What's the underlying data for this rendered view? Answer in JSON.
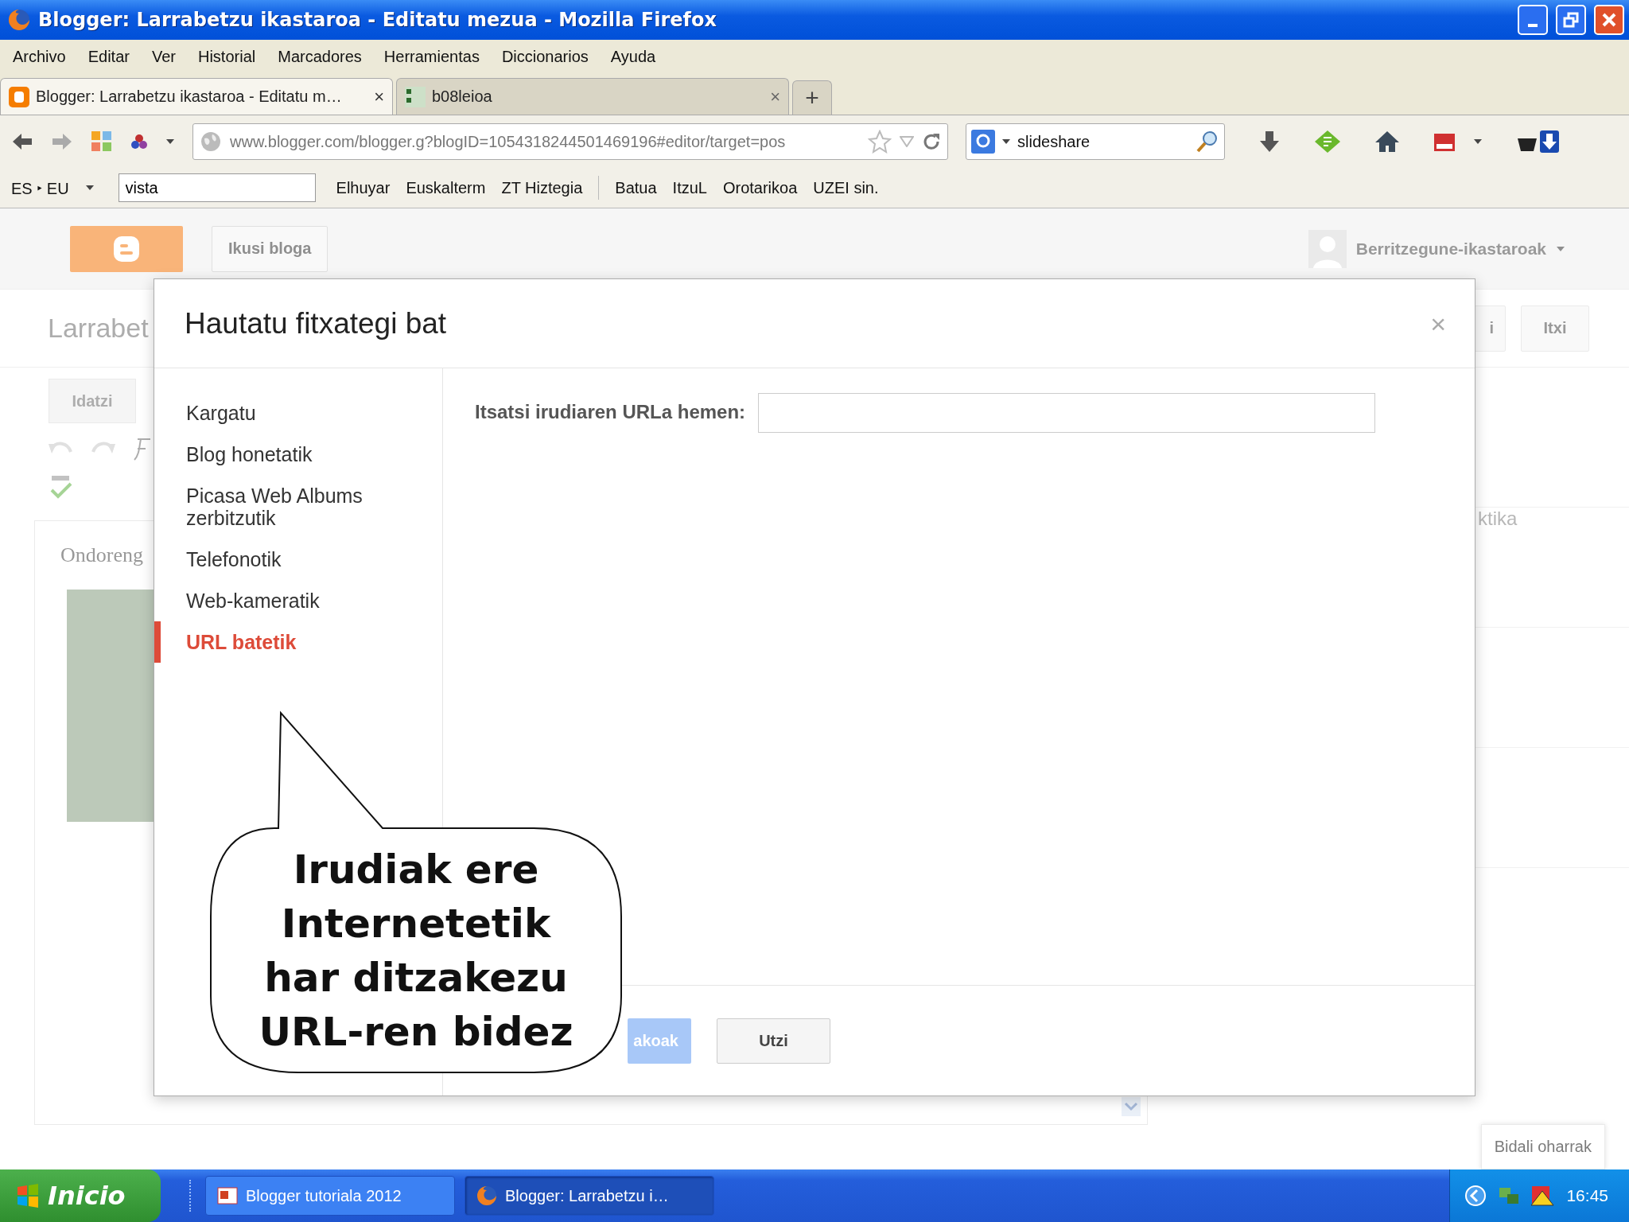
{
  "window": {
    "title": "Blogger: Larrabetzu ikastaroa - Editatu mezua - Mozilla Firefox"
  },
  "menu": [
    "Archivo",
    "Editar",
    "Ver",
    "Historial",
    "Marcadores",
    "Herramientas",
    "Diccionarios",
    "Ayuda"
  ],
  "tabs": [
    {
      "title": "Blogger: Larrabetzu ikastaroa - Editatu m…",
      "selected": true,
      "close": "×",
      "kind": "blogger"
    },
    {
      "title": "b08leioa",
      "selected": false,
      "close": "×",
      "kind": "page"
    }
  ],
  "new_tab": "+",
  "url": "www.blogger.com/blogger.g?blogID=1054318244501469196#editor/target=pos",
  "search": {
    "value": "slideshare"
  },
  "translator": {
    "pair": "ES ‣ EU",
    "value": "vista"
  },
  "bookmark_groups": [
    [
      "Elhuyar",
      "Euskalterm",
      "ZT Hiztegia"
    ],
    [
      "Batua",
      "ItzuL",
      "Orotarikoa",
      "UZEI sin."
    ]
  ],
  "blogger": {
    "view_blog": "Ikusi bloga",
    "account": "Berritzegune-ikastaroak",
    "blog_title": "Larrabet",
    "side_button": "i",
    "close_button": "Itxi",
    "compose_tab": "Idatzi",
    "post_text": "Ondoreng",
    "sidebar_text": "ktika",
    "feedback": "Bidali oharrak"
  },
  "dialog": {
    "title": "Hautatu fitxategi bat",
    "close": "×",
    "sources": [
      {
        "label": "Kargatu",
        "selected": false
      },
      {
        "label": "Blog honetatik",
        "selected": false
      },
      {
        "label": "Picasa Web Albums zerbitzutik",
        "selected": false
      },
      {
        "label": "Telefonotik",
        "selected": false
      },
      {
        "label": "Web-kameratik",
        "selected": false
      },
      {
        "label": "URL batetik",
        "selected": true
      }
    ],
    "url_label": "Itsatsi irudiaren URLa hemen:",
    "select_button": "akoak",
    "cancel_button": "Utzi"
  },
  "callout": {
    "lines": [
      "Irudiak ere",
      "Internetetik",
      "har ditzakezu",
      "URL-ren bidez"
    ]
  },
  "taskbar": {
    "start": "Inicio",
    "tasks": [
      {
        "label": "Blogger tutoriala 2012",
        "selected": false,
        "kind": "slides"
      },
      {
        "label": "Blogger: Larrabetzu i…",
        "selected": true,
        "kind": "browser"
      }
    ],
    "clock": "16:45"
  }
}
